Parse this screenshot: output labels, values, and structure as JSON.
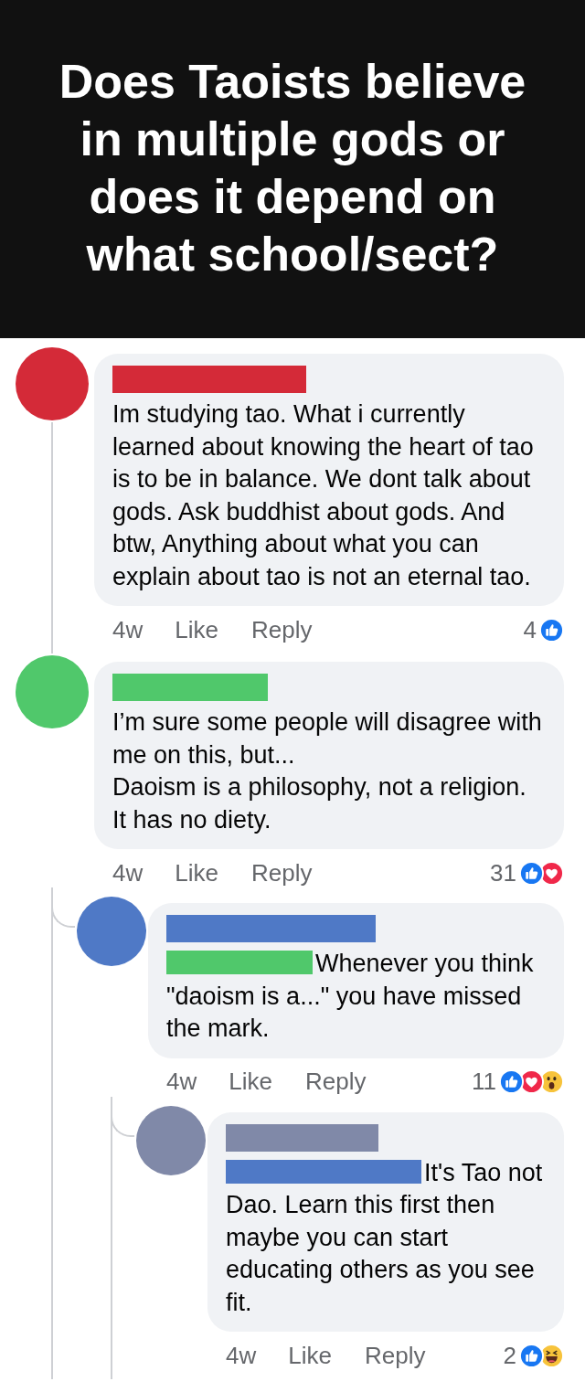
{
  "title": "Does Taoists believe in multiple gods or does it depend on what school/sect?",
  "comments": [
    {
      "avatar": {
        "color": "#d42a38"
      },
      "name_bar": {
        "color": "#d42a38"
      },
      "paragraphs": [
        "Im studying tao. What i currently learned about knowing the heart of tao is to be in balance. We dont talk about gods. Ask buddhist about gods. And btw, Anything about what you can explain about tao is not an eternal tao."
      ],
      "time": "4w",
      "like": "Like",
      "reply": "Reply",
      "count": "4",
      "reactions": [
        {
          "kind": "like"
        }
      ]
    },
    {
      "avatar": {
        "color": "#50c86b"
      },
      "name_bar": {
        "color": "#50c86b"
      },
      "paragraphs": [
        "I’m sure some people will disagree with me on this, but...",
        "Daoism is a philosophy, not a religion.",
        "It has no diety."
      ],
      "time": "4w",
      "like": "Like",
      "reply": "Reply",
      "count": "31",
      "reactions": [
        {
          "kind": "like"
        },
        {
          "kind": "love"
        }
      ],
      "children": [
        {
          "avatar": {
            "color": "#4f79c6"
          },
          "name_bar": {
            "color": "#4f79c6"
          },
          "mention": {
            "color": "#50c86b"
          },
          "paragraphs": [
            "Whenever you think \"daoism is a...\" you have missed the mark."
          ],
          "time": "4w",
          "like": "Like",
          "reply": "Reply",
          "count": "11",
          "reactions": [
            {
              "kind": "like"
            },
            {
              "kind": "love"
            },
            {
              "kind": "wow"
            }
          ],
          "children": [
            {
              "avatar": {
                "color": "#8089a8"
              },
              "name_bar": {
                "color": "#8089a8"
              },
              "mention": {
                "color": "#4f79c6"
              },
              "paragraphs": [
                "It's Tao not Dao. Learn this first then maybe you can start educating others as you see fit."
              ],
              "time": "4w",
              "like": "Like",
              "reply": "Reply",
              "count": "2",
              "reactions": [
                {
                  "kind": "like"
                },
                {
                  "kind": "haha"
                }
              ]
            }
          ]
        }
      ]
    }
  ]
}
